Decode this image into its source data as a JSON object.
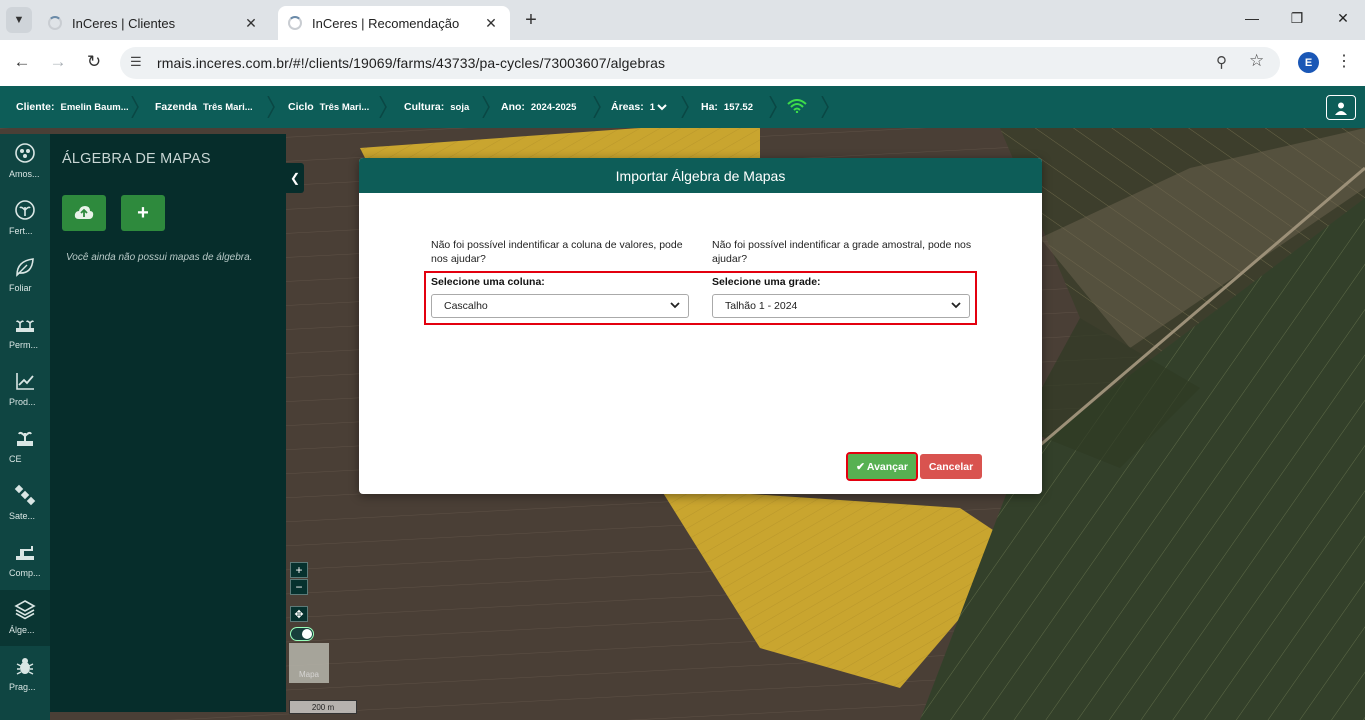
{
  "browser": {
    "tabs": [
      {
        "title": "InCeres | Clientes",
        "active": false
      },
      {
        "title": "InCeres | Recomendação",
        "active": true
      }
    ],
    "url": "rmais.inceres.com.br/#!/clients/19069/farms/43733/pa-cycles/73003607/algebras",
    "profile_initial": "E"
  },
  "appbar": {
    "crumbs": [
      {
        "label": "Cliente:",
        "value": "Emelin Baum..."
      },
      {
        "label": "Fazenda",
        "value": "Três Mari..."
      },
      {
        "label": "Ciclo",
        "value": "Três Mari..."
      },
      {
        "label": "Cultura:",
        "value": "soja"
      },
      {
        "label": "Ano:",
        "value": "2024-2025"
      },
      {
        "label": "Áreas:",
        "value": "1"
      },
      {
        "label": "Ha:",
        "value": "157.52"
      }
    ]
  },
  "leftnav": {
    "items": [
      {
        "label": "Amos...",
        "icon": "sampling-icon"
      },
      {
        "label": "Fert...",
        "icon": "fertility-icon"
      },
      {
        "label": "Foliar",
        "icon": "leaf-icon"
      },
      {
        "label": "Perm...",
        "icon": "permanent-icon"
      },
      {
        "label": "Prod...",
        "icon": "productivity-chart-icon"
      },
      {
        "label": "CE",
        "icon": "plant-icon"
      },
      {
        "label": "Sate...",
        "icon": "satellite-icon"
      },
      {
        "label": "Comp...",
        "icon": "compaction-icon"
      },
      {
        "label": "Álge...",
        "icon": "layers-icon",
        "active": true
      },
      {
        "label": "Prag...",
        "icon": "bug-icon"
      }
    ]
  },
  "sidepanel": {
    "title": "ÁLGEBRA DE MAPAS",
    "empty_message": "Você ainda não possui mapas de álgebra."
  },
  "map": {
    "minimap_label": "Mapa",
    "scale": "200 m",
    "zoom_in": "+",
    "zoom_out": "−"
  },
  "modal": {
    "title": "Importar Álgebra de Mapas",
    "left": {
      "question": "Não foi possível indentificar a coluna de valores, pode nos ajudar?",
      "label": "Selecione uma coluna:",
      "selected": "Cascalho"
    },
    "right": {
      "question": "Não foi possível indentificar a grade amostral, pode nos ajudar?",
      "label": "Selecione uma grade:",
      "selected": "Talhão 1 - 2024"
    },
    "advance_label": "Avançar",
    "cancel_label": "Cancelar"
  },
  "colors": {
    "brand_teal": "#0d5d58",
    "panel_dark": "#062d2b",
    "advance_green": "#57b152",
    "cancel_red": "#d9534f",
    "highlight_red": "#e3000f"
  }
}
